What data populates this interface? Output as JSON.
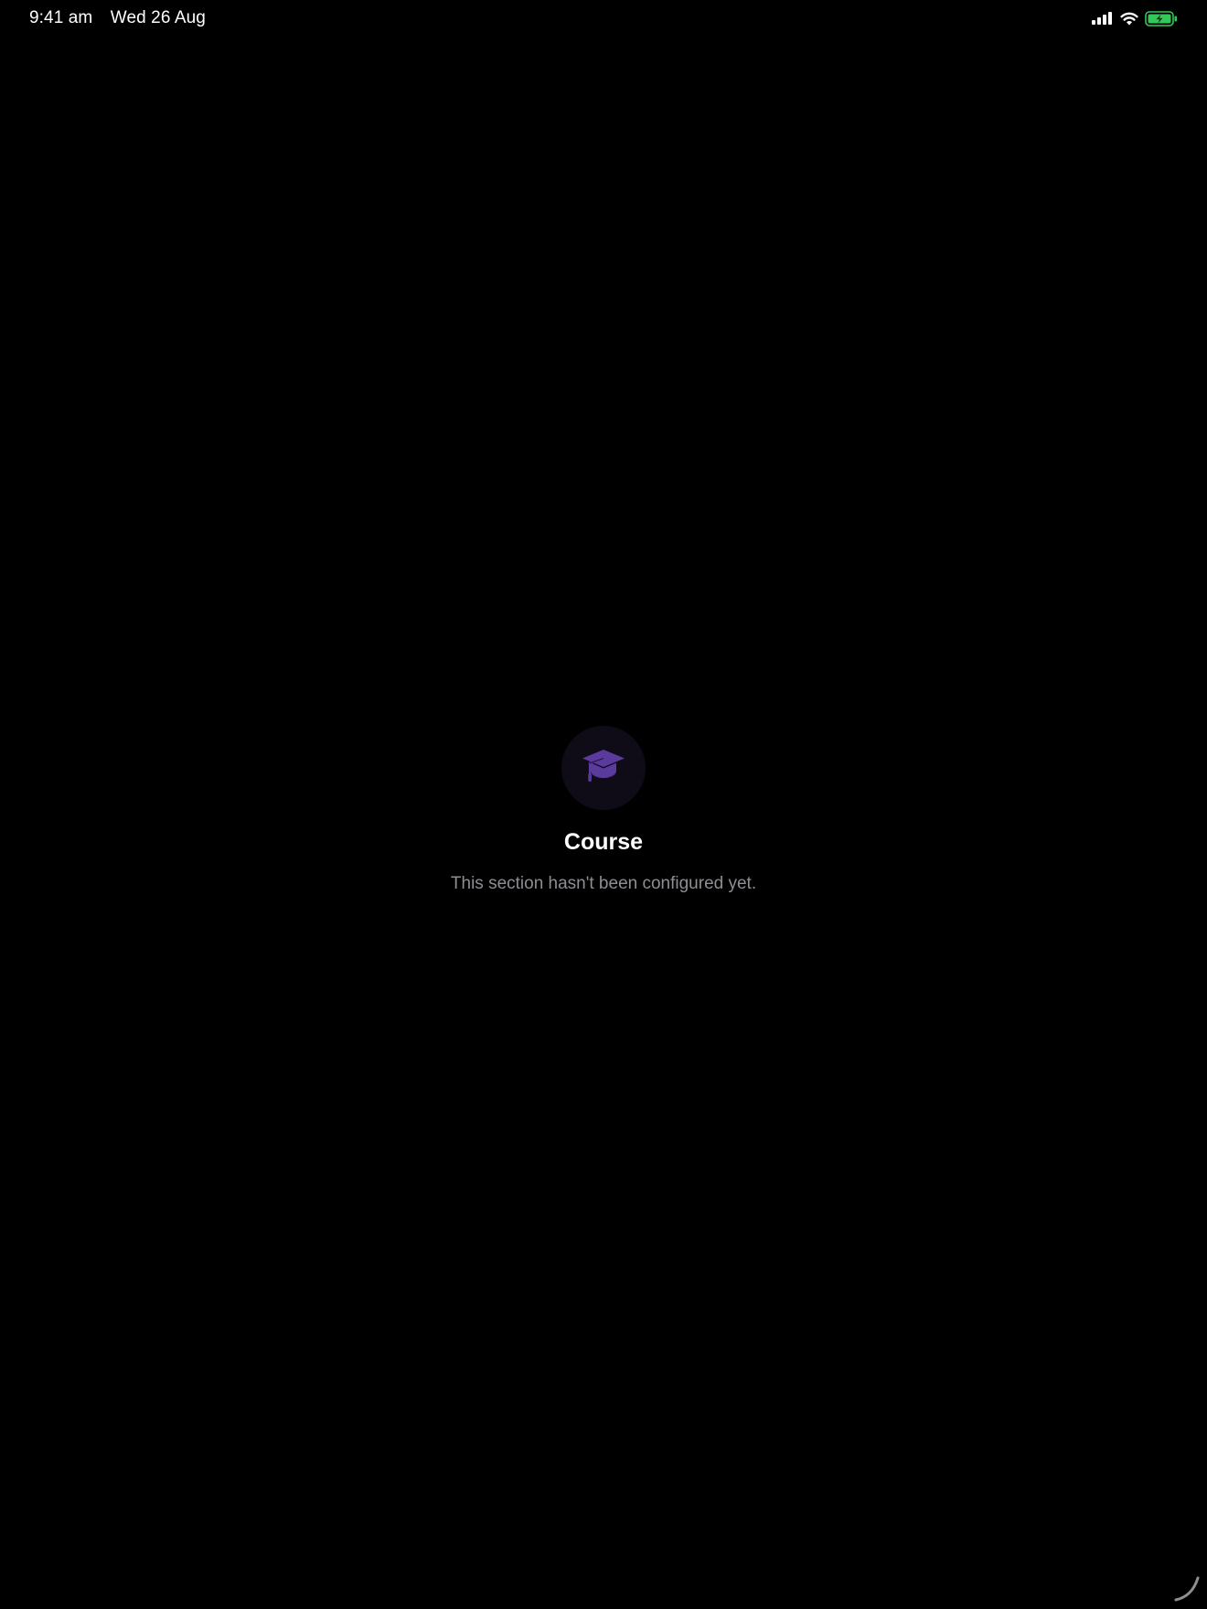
{
  "status_bar": {
    "time": "9:41 am",
    "date": "Wed 26 Aug",
    "icons": [
      "cellular-signal-icon",
      "wifi-icon",
      "battery-charging-icon"
    ],
    "battery_color": "#34c759"
  },
  "empty_state": {
    "icon": "graduation-cap-icon",
    "icon_color": "#5b3a9e",
    "title": "Course",
    "message": "This section hasn't been configured yet."
  },
  "colors": {
    "background": "#000000",
    "primary_text": "#ffffff",
    "secondary_text": "#8e8e93"
  }
}
